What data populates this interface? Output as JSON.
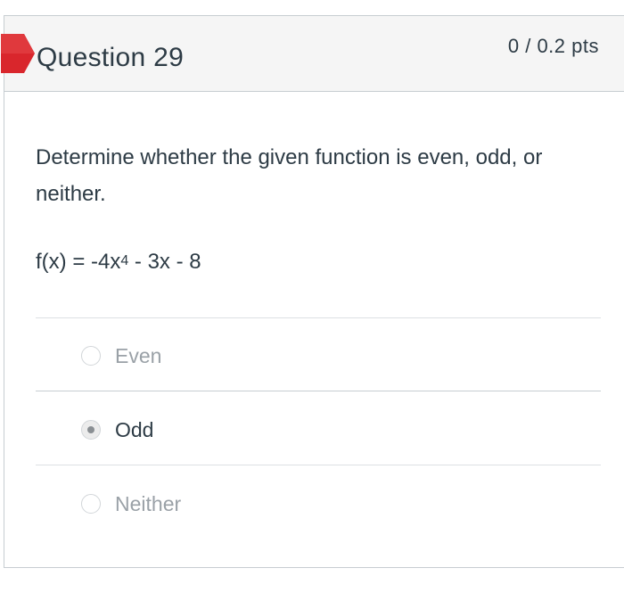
{
  "question": {
    "title": "Question 29",
    "points": "0 / 0.2 pts",
    "prompt": "Determine whether the given function is even, odd, or neither.",
    "formula": {
      "prefix": "f(x) = -4x",
      "exponent": "4",
      "suffix": " - 3x - 8"
    },
    "flag_color": "#d9262c"
  },
  "answers": [
    {
      "label": "Even",
      "selected": false
    },
    {
      "label": "Odd",
      "selected": true
    },
    {
      "label": "Neither",
      "selected": false
    }
  ]
}
